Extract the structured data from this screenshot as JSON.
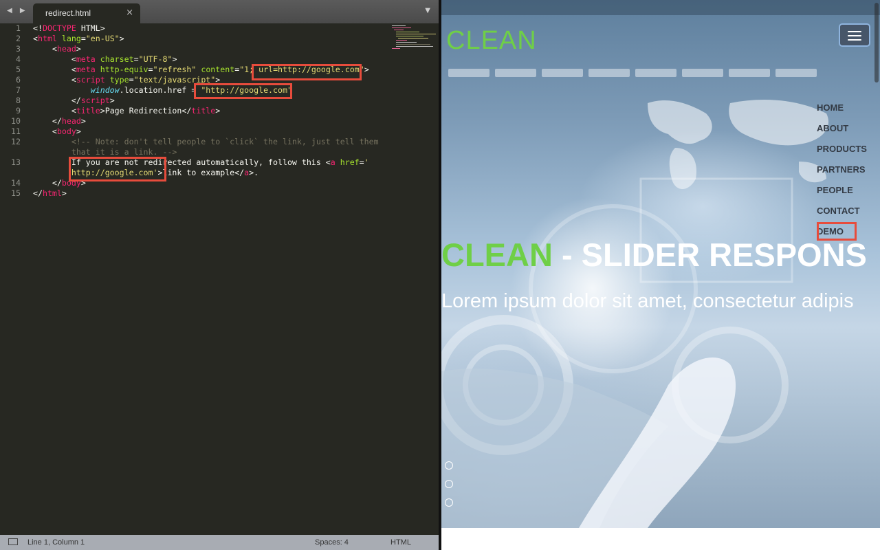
{
  "editor": {
    "tab_title": "redirect.html",
    "close_glyph": "×",
    "nav_glyph": "◀ ▶",
    "dropdown_glyph": "▼",
    "lines": [
      {
        "n": "1",
        "segs": [
          [
            "p",
            "<!"
          ],
          [
            "t",
            "DOCTYPE"
          ],
          [
            "p",
            " HTML>"
          ]
        ]
      },
      {
        "n": "2",
        "segs": [
          [
            "p",
            "<"
          ],
          [
            "t",
            "html"
          ],
          [
            "p",
            " "
          ],
          [
            "a",
            "lang"
          ],
          [
            "p",
            "="
          ],
          [
            "s",
            "\"en-US\""
          ],
          [
            "p",
            ">"
          ]
        ]
      },
      {
        "n": "3",
        "segs": [
          [
            "p",
            "    <"
          ],
          [
            "t",
            "head"
          ],
          [
            "p",
            ">"
          ]
        ]
      },
      {
        "n": "4",
        "segs": [
          [
            "p",
            "        <"
          ],
          [
            "t",
            "meta"
          ],
          [
            "p",
            " "
          ],
          [
            "a",
            "charset"
          ],
          [
            "p",
            "="
          ],
          [
            "s",
            "\"UTF-8\""
          ],
          [
            "p",
            ">"
          ]
        ]
      },
      {
        "n": "5",
        "segs": [
          [
            "p",
            "        <"
          ],
          [
            "t",
            "meta"
          ],
          [
            "p",
            " "
          ],
          [
            "a",
            "http-equiv"
          ],
          [
            "p",
            "="
          ],
          [
            "s",
            "\"refresh\""
          ],
          [
            "p",
            " "
          ],
          [
            "a",
            "content"
          ],
          [
            "p",
            "="
          ],
          [
            "s",
            "\"1; url=http://google.com\""
          ],
          [
            "p",
            ">"
          ]
        ]
      },
      {
        "n": "6",
        "segs": [
          [
            "p",
            "        <"
          ],
          [
            "t",
            "script"
          ],
          [
            "p",
            " "
          ],
          [
            "a",
            "type"
          ],
          [
            "p",
            "="
          ],
          [
            "s",
            "\"text/javascript\""
          ],
          [
            "p",
            ">"
          ]
        ]
      },
      {
        "n": "7",
        "segs": [
          [
            "p",
            "            "
          ],
          [
            "w",
            "window"
          ],
          [
            "p",
            ".location.href = "
          ],
          [
            "s",
            "\"http://google.com\""
          ]
        ]
      },
      {
        "n": "8",
        "segs": [
          [
            "p",
            "        </"
          ],
          [
            "t",
            "script"
          ],
          [
            "p",
            ">"
          ]
        ]
      },
      {
        "n": "9",
        "segs": [
          [
            "p",
            "        <"
          ],
          [
            "t",
            "title"
          ],
          [
            "p",
            ">Page Redirection</"
          ],
          [
            "t",
            "title"
          ],
          [
            "p",
            ">"
          ]
        ]
      },
      {
        "n": "10",
        "segs": [
          [
            "p",
            "    </"
          ],
          [
            "t",
            "head"
          ],
          [
            "p",
            ">"
          ]
        ]
      },
      {
        "n": "11",
        "segs": [
          [
            "p",
            "    <"
          ],
          [
            "t",
            "body"
          ],
          [
            "p",
            ">"
          ]
        ]
      },
      {
        "n": "12",
        "segs": [
          [
            "c",
            "        <!-- Note: don't tell people to `click` the link, just tell them"
          ]
        ]
      },
      {
        "n": "",
        "segs": [
          [
            "c",
            "        that it is a link. -->"
          ]
        ]
      },
      {
        "n": "13",
        "segs": [
          [
            "p",
            "        If you are not redirected automatically, follow this <"
          ],
          [
            "t",
            "a"
          ],
          [
            "p",
            " "
          ],
          [
            "a",
            "href"
          ],
          [
            "p",
            "="
          ],
          [
            "s",
            "'"
          ]
        ]
      },
      {
        "n": "",
        "segs": [
          [
            "s",
            "        http://google.com'"
          ],
          [
            "p",
            ">link to example</"
          ],
          [
            "t",
            "a"
          ],
          [
            "p",
            ">."
          ]
        ]
      },
      {
        "n": "14",
        "segs": [
          [
            "p",
            "    </"
          ],
          [
            "t",
            "body"
          ],
          [
            "p",
            ">"
          ]
        ]
      },
      {
        "n": "15",
        "segs": [
          [
            "p",
            "</"
          ],
          [
            "t",
            "html"
          ],
          [
            "p",
            ">"
          ]
        ]
      }
    ]
  },
  "statusbar": {
    "position": "Line 1, Column 1",
    "spaces": "Spaces: 4",
    "syntax": "HTML"
  },
  "site": {
    "logo": "CLEAN",
    "nav": [
      "HOME",
      "ABOUT",
      "PRODUCTS",
      "PARTNERS",
      "PEOPLE",
      "CONTACT",
      "DEMO"
    ],
    "headline_green": "CLEAN",
    "headline_white": " - SLIDER RESPONS",
    "subline": "Lorem ipsum dolor sit amet, consectetur adipis",
    "slider_dots": 3,
    "active_dot": 0
  },
  "colors": {
    "accent_green": "#6fcf47",
    "highlight_red": "#e74c3c",
    "editor_bg": "#272822"
  }
}
